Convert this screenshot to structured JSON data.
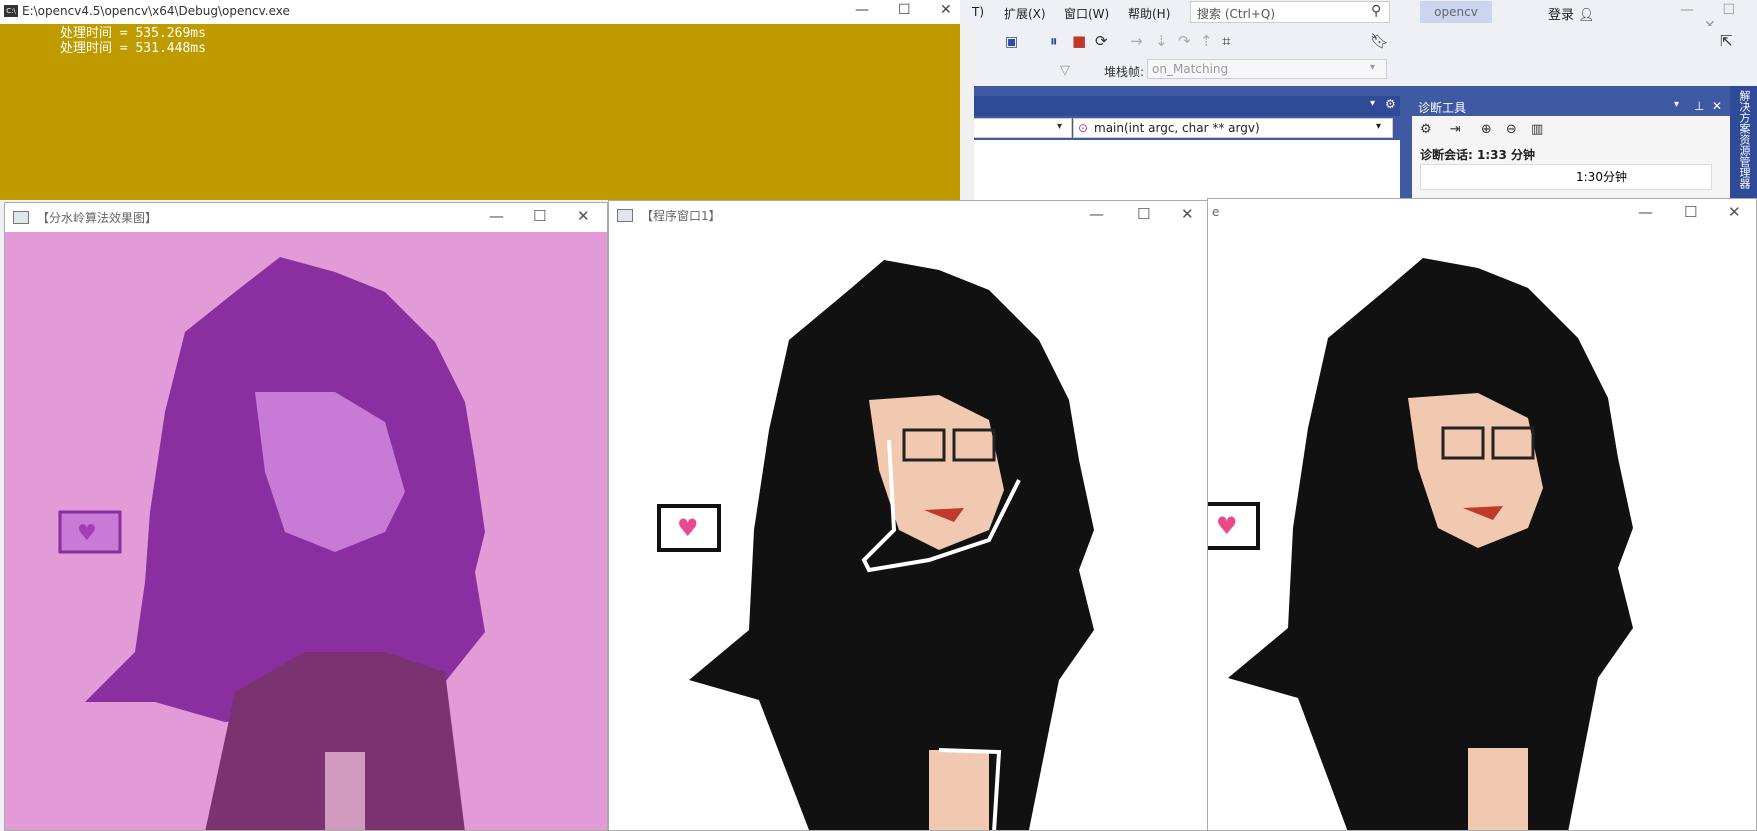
{
  "console": {
    "title": "E:\\opencv4.5\\opencv\\x64\\Debug\\opencv.exe",
    "lines": [
      "处理时间 = 535.269ms",
      "处理时间 = 531.448ms"
    ],
    "controls": {
      "minimize": "—",
      "maximize": "☐",
      "close": "✕"
    }
  },
  "vs": {
    "menu": [
      "T)",
      "扩展(X)",
      "窗口(W)",
      "帮助(H)"
    ],
    "search_placeholder": "搜索 (Ctrl+Q)",
    "project": "opencv",
    "signin": "登录",
    "stackframe_label": "堆栈帧:",
    "stackframe_value": "on_Matching",
    "function_combo": "main(int argc, char ** argv)",
    "diag_title": "诊断工具",
    "diag_session": "诊断会话: 1:33 分钟",
    "diag_timeline_label": "1:30分钟",
    "side_tab": "解决方案资源管理器",
    "colors": {
      "accent": "#3f5aa3",
      "console_bg": "#c09b00"
    }
  },
  "windows": [
    {
      "title": "【分水岭算法效果图】",
      "bg": "#e39bd8"
    },
    {
      "title": "【程序窗口1】",
      "bg": "#ffffff"
    },
    {
      "title": "e",
      "bg": "#ffffff"
    }
  ]
}
